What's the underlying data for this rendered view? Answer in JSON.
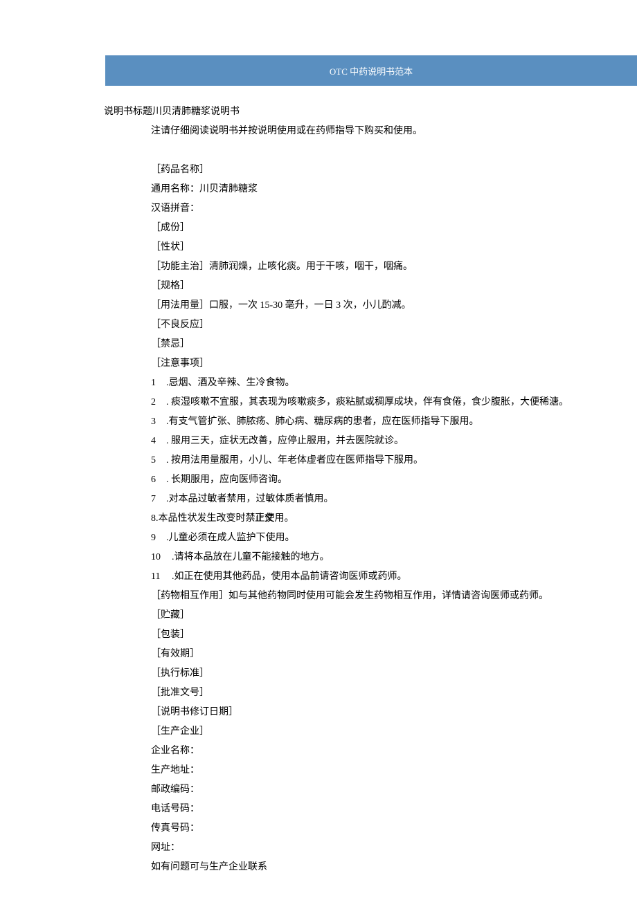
{
  "banner": "OTC 中药说明书范本",
  "title_label": "说明书标题",
  "title_text": "川贝清肺糖浆说明书",
  "sub_label": "注",
  "sub_text": "请仔细阅读说明书并按说明使用或在药师指导下购买和使用。",
  "side_label": "正文",
  "lines": {
    "l0": "［药品名称］",
    "l1": "通用名称：川贝清肺糖浆",
    "l2": "汉语拼音：",
    "l3": "［成份］",
    "l4": "［性状］",
    "l5": "［功能主治］清肺润燥，止咳化痰。用于干咳，咽干，咽痛。",
    "l6": "［规格］",
    "l7": "［用法用量］口服，一次 15-30 毫升，一日 3 次，小儿酌减。",
    "l8": "［不良反应］",
    "l9": "［禁忌］",
    "l10": "［注意事项］",
    "n1": "1",
    "t1": ".忌烟、酒及辛辣、生冷食物。",
    "n2": "2",
    "t2": ". 痰湿咳嗽不宜服，其表现为咳嗽痰多，痰粘腻或稠厚成块，伴有食倦，食少腹胀，大便稀溏。",
    "n3": "3",
    "t3": ".有支气管扩张、肺脓疡、肺心病、糖尿病的患者，应在医师指导下服用。",
    "n4": "4",
    "t4": ". 服用三天，症状无改善，应停止服用，并去医院就诊。",
    "n5": "5",
    "t5": ". 按用法用量服用，小儿、年老体虚者应在医师指导下服用。",
    "n6": "6",
    "t6": ". 长期服用，应向医师咨询。",
    "n7": "7",
    "t7": ".对本品过敏者禁用，过敏体质者慎用。",
    "t8": "8.本品性状发生改变时禁止使用。",
    "n9": "9",
    "t9": ".儿童必须在成人监护下使用。",
    "n10": "10",
    "t10": ".请将本品放在儿童不能接触的地方。",
    "n11": "11",
    "t11": ".如正在使用其他药品，使用本品前请咨询医师或药师。",
    "l11": "［药物相互作用］如与其他药物同时使用可能会发生药物相互作用，详情请咨询医师或药师。",
    "l12": "［贮藏］",
    "l13": "［包装］",
    "l14": "［有效期］",
    "l15": "［执行标准］",
    "l16": "［批准文号］",
    "l17": "［说明书修订日期］",
    "l18": "［生产企业］",
    "l19": "企业名称：",
    "l20": "生产地址：",
    "l21": "邮政编码：",
    "l22": "电话号码：",
    "l23": "传真号码：",
    "l24": "网址：",
    "l25": "如有问题可与生产企业联系"
  }
}
